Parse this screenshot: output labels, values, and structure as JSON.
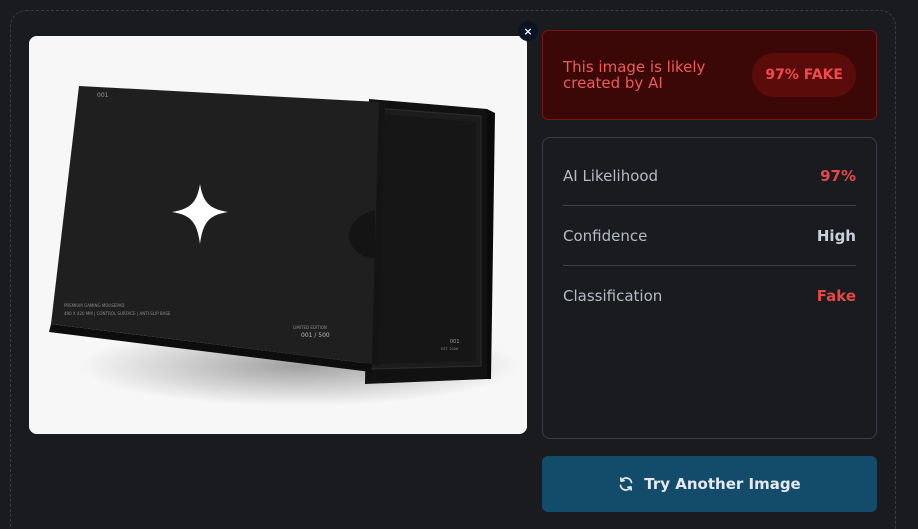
{
  "preview": {
    "close_glyph": "×",
    "image_desc_icon": "product-box-image",
    "product": {
      "corner_code": "001",
      "line1": "PREMIUM GAMING MOUSEPAD",
      "line2": "490 X 420 MM  |  CONTROL SURFACE  |  ANTI-SLIP BASE",
      "edition_label": "LIMITED EDITION",
      "edition_number": "001 / 500",
      "pad_code": "001",
      "pad_est": "EST. 2026"
    }
  },
  "verdict": {
    "message": "This image is likely created by AI",
    "badge": "97% FAKE"
  },
  "stats": [
    {
      "label": "AI Likelihood",
      "value": "97%",
      "color": "#e54848"
    },
    {
      "label": "Confidence",
      "value": "High",
      "color": "#c9d1dd"
    },
    {
      "label": "Classification",
      "value": "Fake",
      "color": "#e54848"
    }
  ],
  "actions": {
    "try_another_label": "Try Another Image",
    "try_another_icon": "refresh-icon"
  }
}
